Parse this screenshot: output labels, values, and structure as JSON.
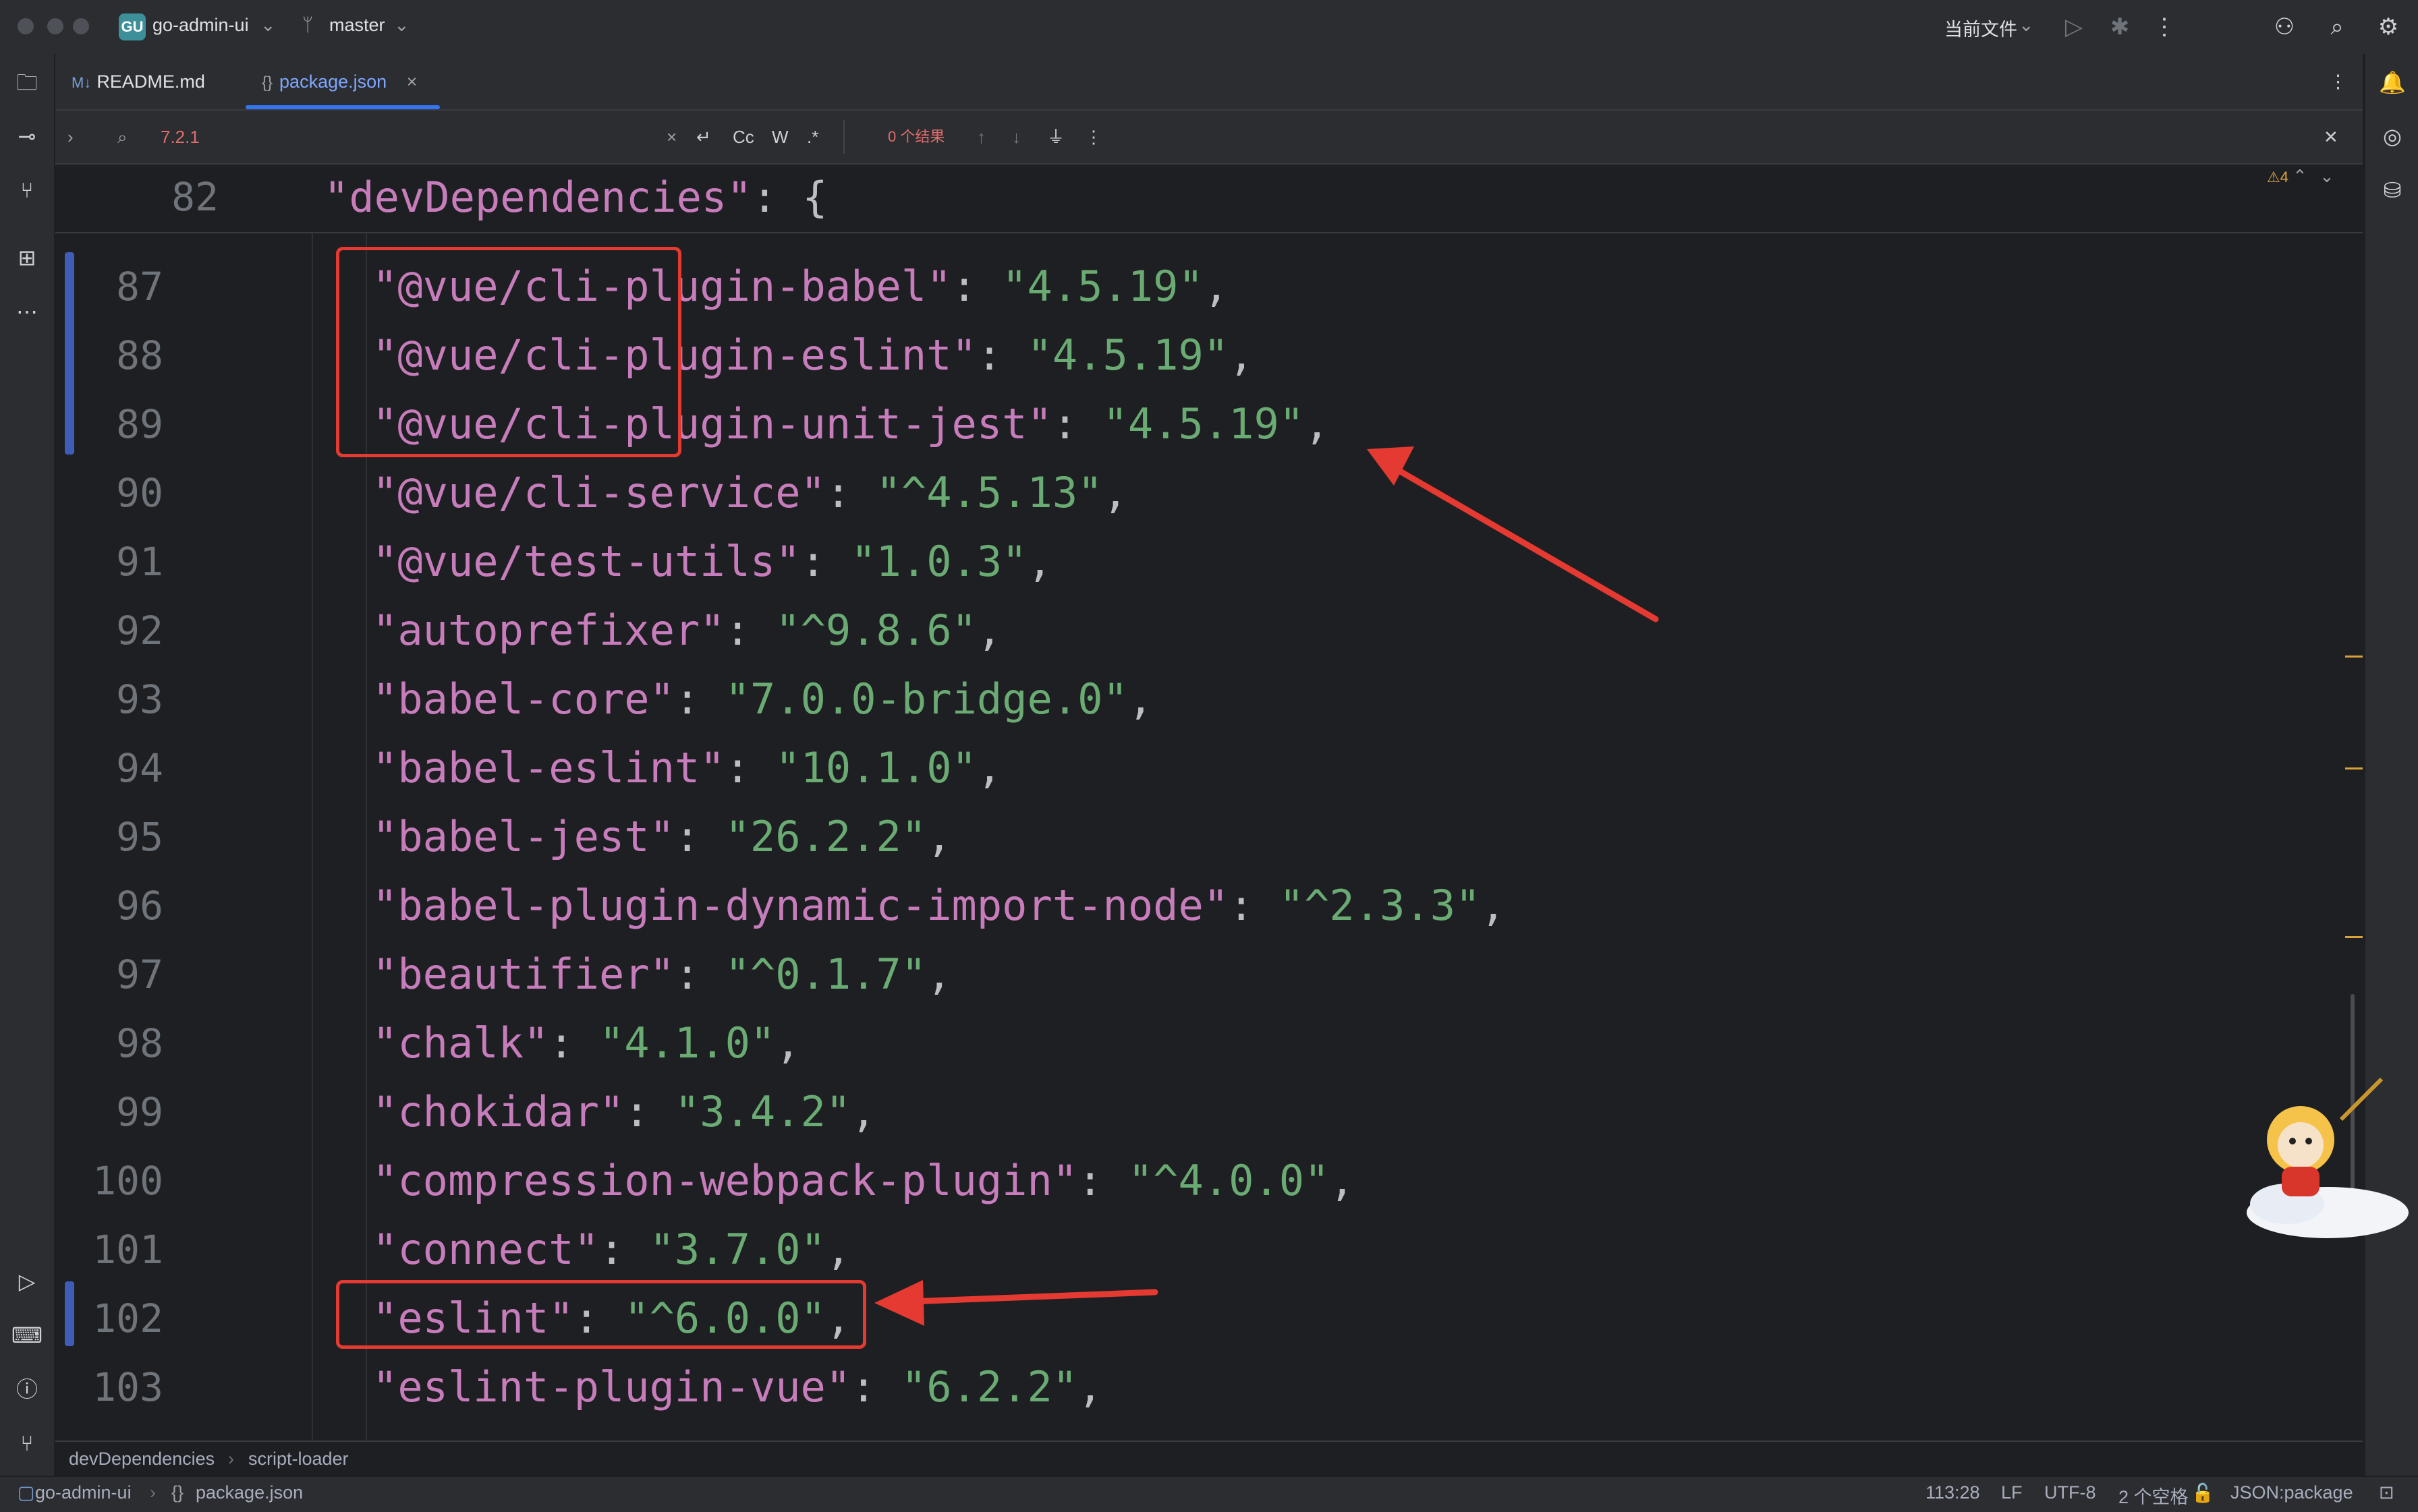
{
  "titlebar": {
    "project_badge": "GU",
    "project_name": "go-admin-ui",
    "branch": "master",
    "run_config": "当前文件"
  },
  "tabs": [
    {
      "icon": "M↓",
      "label": "README.md"
    },
    {
      "icon": "{}",
      "label": "package.json"
    }
  ],
  "find": {
    "query": "7.2.1",
    "case_label": "Cc",
    "word_label": "W",
    "regex_label": ".*",
    "results": "0 个结果"
  },
  "editor": {
    "inspection_count": "4",
    "sticky": {
      "line": "82",
      "key": "\"devDependencies\"",
      "rest": ": {"
    },
    "lines": [
      {
        "n": "87",
        "key": "\"@vue/cli-plugin-babel\"",
        "val": "\"4.5.19\""
      },
      {
        "n": "88",
        "key": "\"@vue/cli-plugin-eslint\"",
        "val": "\"4.5.19\""
      },
      {
        "n": "89",
        "key": "\"@vue/cli-plugin-unit-jest\"",
        "val": "\"4.5.19\""
      },
      {
        "n": "90",
        "key": "\"@vue/cli-service\"",
        "val": "\"^4.5.13\""
      },
      {
        "n": "91",
        "key": "\"@vue/test-utils\"",
        "val": "\"1.0.3\""
      },
      {
        "n": "92",
        "key": "\"autoprefixer\"",
        "val": "\"^9.8.6\""
      },
      {
        "n": "93",
        "key": "\"babel-core\"",
        "val": "\"7.0.0-bridge.0\""
      },
      {
        "n": "94",
        "key": "\"babel-eslint\"",
        "val": "\"10.1.0\""
      },
      {
        "n": "95",
        "key": "\"babel-jest\"",
        "val": "\"26.2.2\""
      },
      {
        "n": "96",
        "key": "\"babel-plugin-dynamic-import-node\"",
        "val": "\"^2.3.3\""
      },
      {
        "n": "97",
        "key": "\"beautifier\"",
        "val": "\"^0.1.7\""
      },
      {
        "n": "98",
        "key": "\"chalk\"",
        "val": "\"4.1.0\""
      },
      {
        "n": "99",
        "key": "\"chokidar\"",
        "val": "\"3.4.2\""
      },
      {
        "n": "100",
        "key": "\"compression-webpack-plugin\"",
        "val": "\"^4.0.0\""
      },
      {
        "n": "101",
        "key": "\"connect\"",
        "val": "\"3.7.0\""
      },
      {
        "n": "102",
        "key": "\"eslint\"",
        "val": "\"^6.0.0\""
      },
      {
        "n": "103",
        "key": "\"eslint-plugin-vue\"",
        "val": "\"6.2.2\""
      }
    ]
  },
  "breadcrumb": [
    "devDependencies",
    "script-loader"
  ],
  "statusbar": {
    "project": "go-admin-ui",
    "file": "package.json",
    "position": "113:28",
    "line_sep": "LF",
    "encoding": "UTF-8",
    "indent": "2 个空格",
    "file_type": "JSON:package"
  }
}
